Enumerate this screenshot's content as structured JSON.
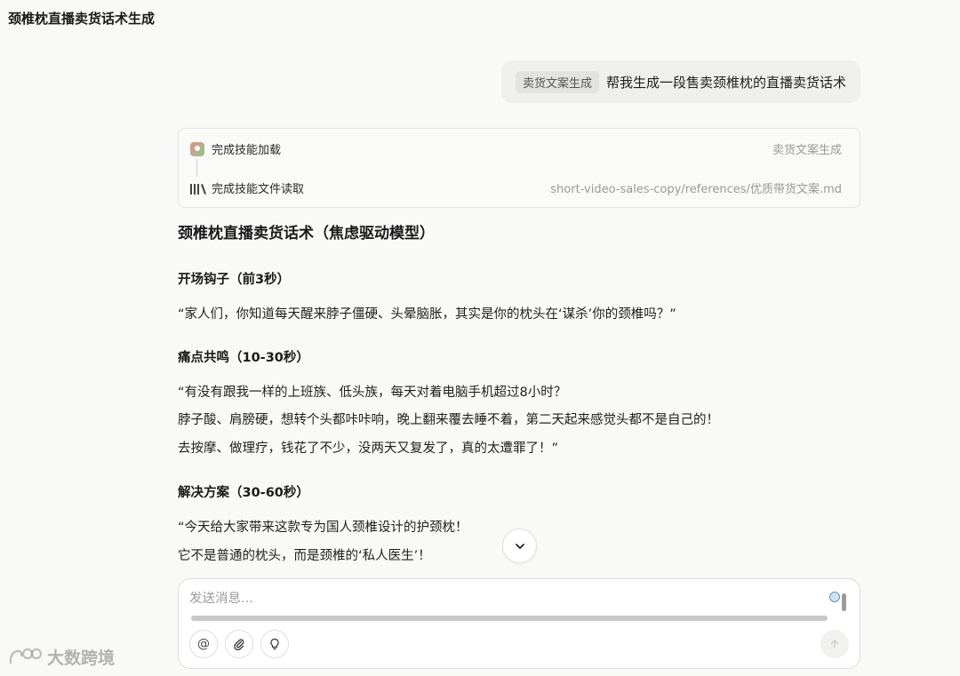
{
  "page": {
    "title": "颈椎枕直播卖货话术生成"
  },
  "user_message": {
    "skill_tag": "卖货文案生成",
    "text": "帮我生成一段售卖颈椎枕的直播卖货话术"
  },
  "skill_steps": [
    {
      "icon": "skill-load-icon",
      "label": "完成技能加载",
      "detail": "卖货文案生成"
    },
    {
      "icon": "books-icon",
      "label": "完成技能文件读取",
      "detail": "short-video-sales-copy/references/优质带货文案.md"
    }
  ],
  "response": {
    "title": "颈椎枕直播卖货话术（焦虑驱动模型）",
    "sections": [
      {
        "heading": "开场钩子（前3秒）",
        "lines": [
          "“家人们，你知道每天醒来脖子僵硬、头晕脑胀，其实是你的枕头在‘谋杀’你的颈椎吗？”"
        ]
      },
      {
        "heading": "痛点共鸣（10-30秒）",
        "lines": [
          "“有没有跟我一样的上班族、低头族，每天对着电脑手机超过8小时？",
          "脖子酸、肩膀硬，想转个头都咔咔响，晚上翻来覆去睡不着，第二天起来感觉头都不是自己的！",
          "去按摩、做理疗，钱花了不少，没两天又复发了，真的太遭罪了！”"
        ]
      },
      {
        "heading": "解决方案（30-60秒）",
        "lines": [
          "“今天给大家带来这款专为国人颈椎设计的护颈枕！",
          "它不是普通的枕头，而是颈椎的‘私人医生’！"
        ]
      }
    ]
  },
  "composer": {
    "placeholder": "发送消息..."
  },
  "icons": {
    "scroll_down": "chevron-down-icon",
    "mention": "at-icon",
    "attach": "paperclip-icon",
    "idea": "lightbulb-icon",
    "send": "arrow-up-icon"
  },
  "watermark": {
    "text": "大数跨境"
  }
}
